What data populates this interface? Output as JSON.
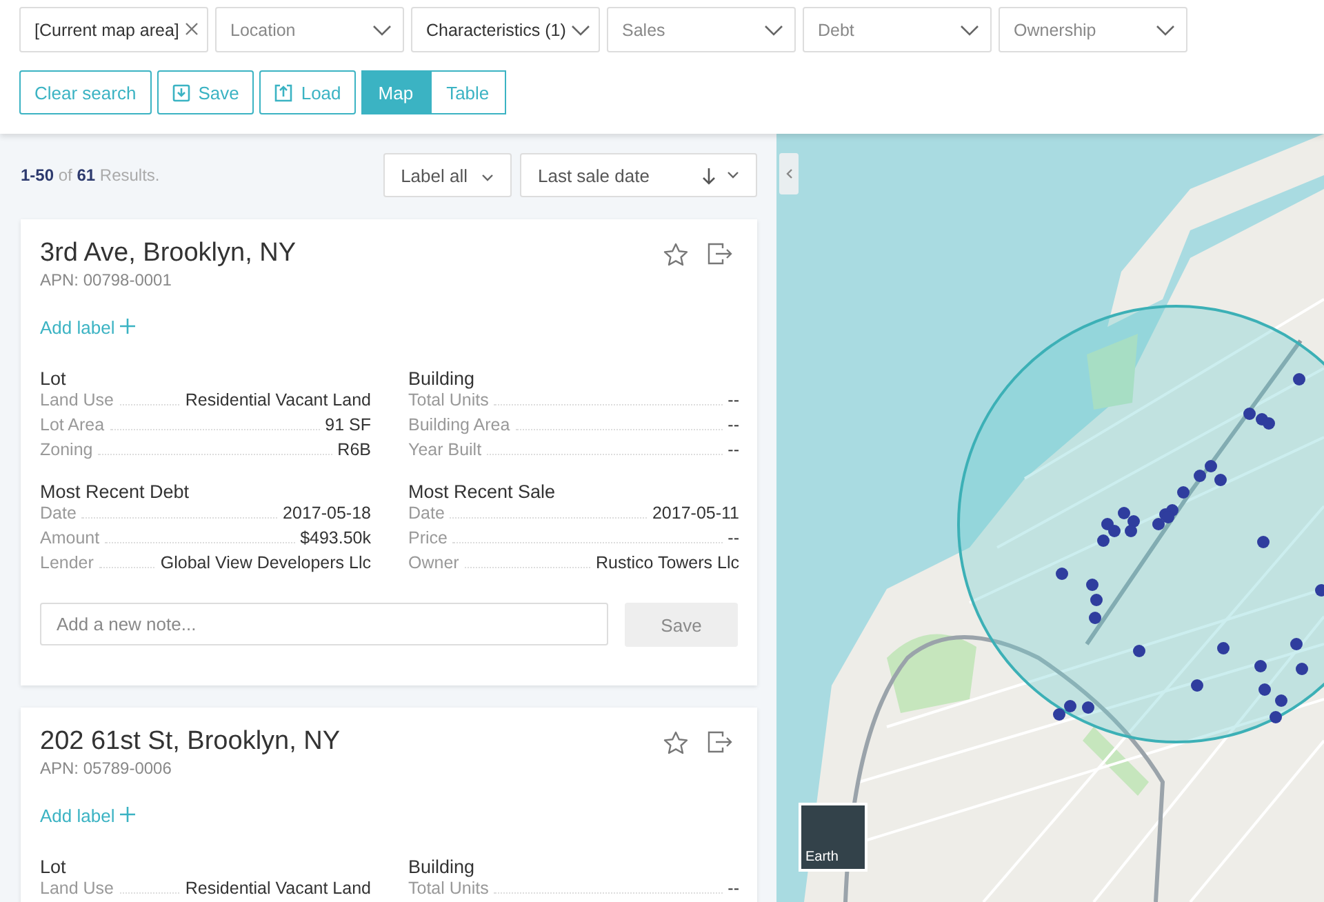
{
  "filters": [
    {
      "label": "[Current map area]",
      "kind": "clearable",
      "active": true
    },
    {
      "label": "Location",
      "kind": "dropdown",
      "active": false
    },
    {
      "label": "Characteristics (1)",
      "kind": "dropdown",
      "active": true
    },
    {
      "label": "Sales",
      "kind": "dropdown",
      "active": false
    },
    {
      "label": "Debt",
      "kind": "dropdown",
      "active": false
    },
    {
      "label": "Ownership",
      "kind": "dropdown",
      "active": false
    }
  ],
  "actions": [
    {
      "label": "Clear search",
      "kind": "text"
    },
    {
      "label": "Save",
      "kind": "save"
    },
    {
      "label": "Load",
      "kind": "load"
    }
  ],
  "view_toggle": [
    {
      "label": "Map",
      "selected": true
    },
    {
      "label": "Table",
      "selected": false
    }
  ],
  "results": {
    "summary": "**1-50** of **61** Results.",
    "label_all": "Label all",
    "sort": "Last sale date"
  },
  "cards": [
    {
      "title": "3rd Ave, Brooklyn, NY",
      "apn": "APN: 00798-0001",
      "add_label": "Add label",
      "sections": [
        {
          "heading": "Lot",
          "rows": [
            {
              "label": "Land Use",
              "value": "Residential Vacant Land"
            },
            {
              "label": "Lot Area",
              "value": "91 SF"
            },
            {
              "label": "Zoning",
              "value": "R6B"
            }
          ]
        },
        {
          "heading": "Building",
          "rows": [
            {
              "label": "Total Units",
              "value": "--"
            },
            {
              "label": "Building Area",
              "value": "--"
            },
            {
              "label": "Year Built",
              "value": "--"
            }
          ]
        },
        {
          "heading": "Most Recent Debt",
          "rows": [
            {
              "label": "Date",
              "value": "2017-05-18"
            },
            {
              "label": "Amount",
              "value": "$493.50k"
            },
            {
              "label": "Lender",
              "value": "Global View Developers Llc"
            }
          ]
        },
        {
          "heading": "Most Recent Sale",
          "rows": [
            {
              "label": "Date",
              "value": "2017-05-11"
            },
            {
              "label": "Price",
              "value": "--"
            },
            {
              "label": "Owner",
              "value": "Rustico Towers Llc"
            }
          ]
        }
      ],
      "note": {
        "placeholder": "Add a new note...",
        "button": "Save",
        "button_disabled": true
      }
    },
    {
      "title": "202 61st St, Brooklyn, NY",
      "apn": "APN: 05789-0006",
      "add_label": "Add label",
      "sections": [
        {
          "heading": "Lot",
          "rows": [
            {
              "label": "Land Use",
              "value": "Residential Vacant Land"
            }
          ]
        },
        {
          "heading": "Building",
          "rows": [
            {
              "label": "Total Units",
              "value": "--"
            }
          ]
        }
      ]
    }
  ],
  "map": {
    "layer_toggle": "Earth"
  }
}
